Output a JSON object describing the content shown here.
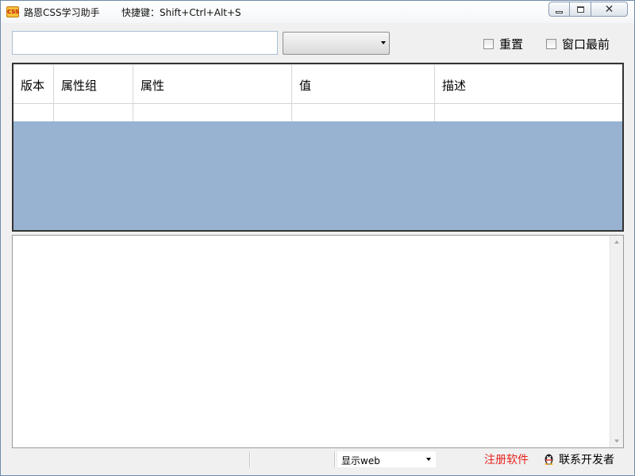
{
  "window": {
    "title": "路恩CSS学习助手",
    "hotkey_hint": "快捷键：Shift+Ctrl+Alt+S",
    "app_icon_text": "CSS"
  },
  "toolbar": {
    "search_value": "",
    "combo_value": "",
    "reset_label": "重置",
    "reset_checked": false,
    "topmost_label": "窗口最前",
    "topmost_checked": false
  },
  "grid": {
    "columns": [
      "版本",
      "属性组",
      "属性",
      "值",
      "描述"
    ],
    "rows": [
      [
        "",
        "",
        "",
        "",
        ""
      ]
    ],
    "empty_area_color": "#97b3d1"
  },
  "detail": {
    "content": ""
  },
  "statusbar": {
    "display_mode": "显示web",
    "register_label": "注册软件",
    "register_color": "#e8231c",
    "contact_label": "联系开发者"
  },
  "icons": [
    "app-logo-icon",
    "minimize-icon",
    "maximize-icon",
    "close-icon",
    "chevron-down-icon",
    "scroll-up-icon",
    "scroll-down-icon",
    "qq-penguin-icon"
  ]
}
